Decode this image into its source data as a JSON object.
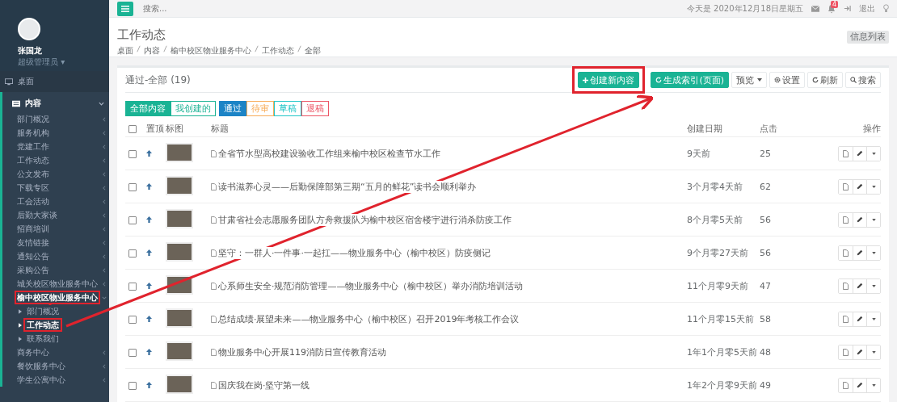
{
  "user": {
    "name": "张国龙",
    "role": "超级管理员 ▾"
  },
  "sidebar": {
    "items": [
      {
        "label": "桌面",
        "kind": "top"
      },
      {
        "label": "内容",
        "kind": "section",
        "expanded": true,
        "children": [
          {
            "label": "部门概况",
            "expanded": false,
            "highlighted": false
          },
          {
            "label": "服务机构",
            "expanded": false,
            "highlighted": false
          },
          {
            "label": "党建工作",
            "expanded": false,
            "highlighted": false
          },
          {
            "label": "工作动态",
            "expanded": false,
            "highlighted": false
          },
          {
            "label": "公文发布",
            "expanded": false,
            "highlighted": false
          },
          {
            "label": "下载专区",
            "expanded": false,
            "highlighted": false
          },
          {
            "label": "工会活动",
            "expanded": false,
            "highlighted": false
          },
          {
            "label": "后勤大家谈",
            "expanded": false,
            "highlighted": false
          },
          {
            "label": "招商培训",
            "expanded": false,
            "highlighted": false
          },
          {
            "label": "友情链接",
            "expanded": false,
            "highlighted": false
          },
          {
            "label": "通知公告",
            "expanded": false,
            "highlighted": false
          },
          {
            "label": "采购公告",
            "expanded": false,
            "highlighted": false
          },
          {
            "label": "城关校区物业服务中心",
            "expanded": false,
            "highlighted": false
          },
          {
            "label": "榆中校区物业服务中心",
            "expanded": true,
            "highlighted": true,
            "children": [
              {
                "label": "部门概况",
                "selected": false,
                "highlighted": false
              },
              {
                "label": "工作动态",
                "selected": true,
                "highlighted": true
              },
              {
                "label": "联系我们",
                "selected": false,
                "highlighted": false
              }
            ]
          },
          {
            "label": "商务中心",
            "expanded": false,
            "highlighted": false
          },
          {
            "label": "餐饮服务中心",
            "expanded": false,
            "highlighted": false
          },
          {
            "label": "学生公寓中心",
            "expanded": false,
            "highlighted": false
          }
        ]
      }
    ]
  },
  "topbar": {
    "search_placeholder": "搜索...",
    "date": "今天是 2020年12月18日星期五",
    "notification_count": "4",
    "logout": "退出"
  },
  "page": {
    "title": "工作动态",
    "breadcrumb": [
      "桌面",
      "内容",
      "榆中校区物业服务中心",
      "工作动态",
      "全部"
    ],
    "badge": "信息列表"
  },
  "panel": {
    "title": "通过-全部 (19)",
    "buttons": [
      {
        "label": "创建新内容",
        "kind": "create",
        "highlighted": true
      },
      {
        "label": "生成索引(页面)",
        "kind": "generate",
        "highlighted": false
      },
      {
        "label": "预览",
        "kind": "preview",
        "highlighted": false
      },
      {
        "label": "设置",
        "kind": "settings",
        "highlighted": false
      },
      {
        "label": "刷新",
        "kind": "refresh",
        "highlighted": false
      },
      {
        "label": "搜索",
        "kind": "search",
        "highlighted": false
      }
    ],
    "scope_tabs": [
      {
        "label": "全部内容",
        "selected": true
      },
      {
        "label": "我创建的",
        "selected": false
      }
    ],
    "status_tabs": [
      {
        "label": "通过",
        "selected": true,
        "color": "#1c84c6"
      },
      {
        "label": "待审",
        "selected": false,
        "color": "#f8ac59"
      },
      {
        "label": "草稿",
        "selected": false,
        "color": "#23c6c8"
      },
      {
        "label": "退稿",
        "selected": false,
        "color": "#ed5565"
      }
    ]
  },
  "table": {
    "select_all_checked": false,
    "columns": [
      "置顶",
      "标图",
      "标题",
      "创建日期",
      "点击",
      "操作"
    ],
    "rows": [
      {
        "checked": false,
        "pinned": true,
        "title": "全省节水型高校建设验收工作组来榆中校区检查节水工作",
        "date": "9天前",
        "clicks": "25"
      },
      {
        "checked": false,
        "pinned": true,
        "title": "读书滋养心灵——后勤保障部第三期“五月的鲜花”读书会顺利举办",
        "date": "3个月零4天前",
        "clicks": "62"
      },
      {
        "checked": false,
        "pinned": true,
        "title": "甘肃省社会志愿服务团队方舟救援队为榆中校区宿舍楼宇进行消杀防疫工作",
        "date": "8个月零5天前",
        "clicks": "56"
      },
      {
        "checked": false,
        "pinned": true,
        "title": "坚守：一群人·一件事·一起扛——物业服务中心（榆中校区）防疫侧记",
        "date": "9个月零27天前",
        "clicks": "56"
      },
      {
        "checked": false,
        "pinned": true,
        "title": "心系师生安全·规范消防管理——物业服务中心（榆中校区）举办消防培训活动",
        "date": "11个月零9天前",
        "clicks": "47"
      },
      {
        "checked": false,
        "pinned": true,
        "title": "总结成绩·展望未来——物业服务中心（榆中校区）召开2019年考核工作会议",
        "date": "11个月零15天前",
        "clicks": "58"
      },
      {
        "checked": false,
        "pinned": true,
        "title": "物业服务中心开展119消防日宣传教育活动",
        "date": "1年1个月零5天前",
        "clicks": "48"
      },
      {
        "checked": false,
        "pinned": true,
        "title": "国庆我在岗·坚守第一线",
        "date": "1年2个月零9天前",
        "clicks": "49"
      }
    ]
  }
}
